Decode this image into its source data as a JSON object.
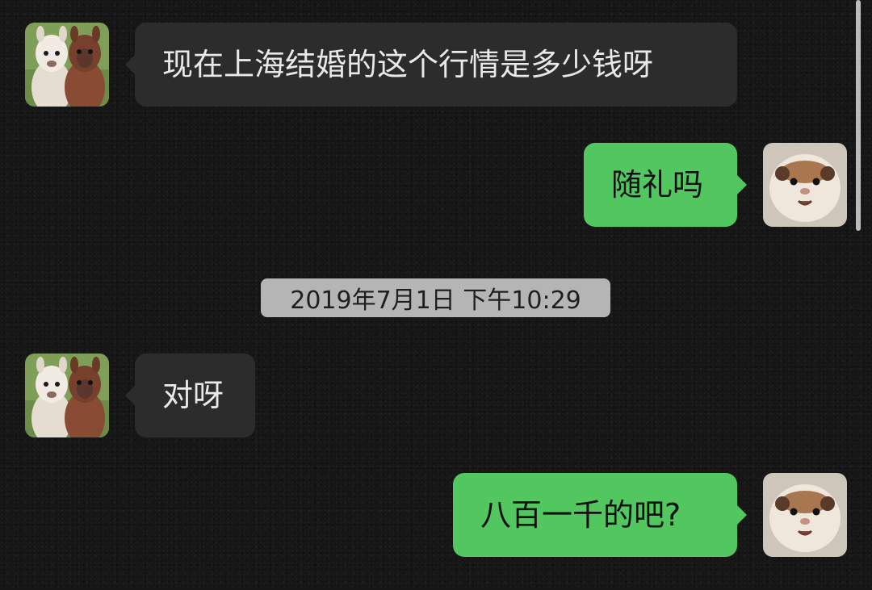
{
  "messages": [
    {
      "sender": "other",
      "text": "现在上海结婚的这个行情是多少钱呀"
    },
    {
      "sender": "me",
      "text": "随礼吗"
    },
    {
      "sender": "other",
      "text": "对呀"
    },
    {
      "sender": "me",
      "text": "八百一千的吧?"
    }
  ],
  "timestamp": "2019年7月1日 下午10:29",
  "colors": {
    "background": "#161616",
    "incoming_bubble": "#2c2c2c",
    "outgoing_bubble": "#52c760",
    "timestamp_pill": "#b5b5b5"
  },
  "icons": {
    "other_avatar": "alpaca-avatar-icon",
    "me_avatar": "hamster-avatar-icon"
  }
}
